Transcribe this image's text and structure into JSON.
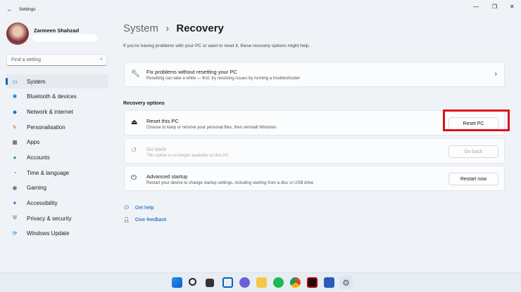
{
  "window": {
    "title": "Settings",
    "minimize": "—",
    "maximize": "❐",
    "close": "✕"
  },
  "user": {
    "name": "Zarmeen Shahzad"
  },
  "search": {
    "placeholder": "Find a setting"
  },
  "sidebar": {
    "items": [
      {
        "label": "System",
        "icon": "▭",
        "color": "#0067c0"
      },
      {
        "label": "Bluetooth & devices",
        "icon": "✱",
        "color": "#0078d4"
      },
      {
        "label": "Network & internet",
        "icon": "◆",
        "color": "#1a73c8"
      },
      {
        "label": "Personalisation",
        "icon": "✎",
        "color": "#c86a2a"
      },
      {
        "label": "Apps",
        "icon": "▦",
        "color": "#555"
      },
      {
        "label": "Accounts",
        "icon": "●",
        "color": "#2a9d5a"
      },
      {
        "label": "Time & language",
        "icon": "◔",
        "color": "#1a8ad0"
      },
      {
        "label": "Gaming",
        "icon": "◉",
        "color": "#666"
      },
      {
        "label": "Accessibility",
        "icon": "✦",
        "color": "#1a5fb4"
      },
      {
        "label": "Privacy & security",
        "icon": "⛨",
        "color": "#666"
      },
      {
        "label": "Windows Update",
        "icon": "⟳",
        "color": "#0078d4"
      }
    ]
  },
  "main": {
    "breadcrumb_parent": "System",
    "breadcrumb_sep": "›",
    "title": "Recovery",
    "subtitle": "If you're having problems with your PC or want to reset it, these recovery options might help.",
    "fix": {
      "title": "Fix problems without resetting your PC",
      "desc": "Resetting can take a while — first, try resolving issues by running a troubleshooter"
    },
    "section": "Recovery options",
    "options": [
      {
        "title": "Reset this PC",
        "desc": "Choose to keep or remove your personal files, then reinstall Windows",
        "button": "Reset PC"
      },
      {
        "title": "Go back",
        "desc": "This option is no longer available on this PC",
        "button": "Go back"
      },
      {
        "title": "Advanced startup",
        "desc": "Restart your device to change startup settings, including starting from a disc or USB drive",
        "button": "Restart now"
      }
    ],
    "links": [
      {
        "label": "Get help"
      },
      {
        "label": "Give feedback"
      }
    ]
  },
  "highlight_color": "#e0101a"
}
